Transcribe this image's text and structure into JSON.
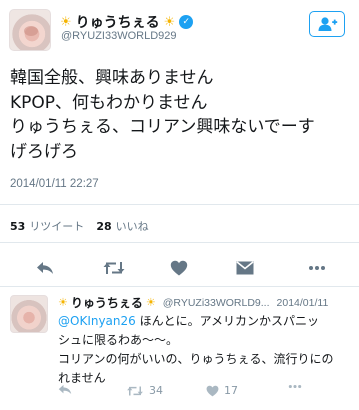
{
  "tweet": {
    "display_name": "りゅうちぇる",
    "handle": "@RYUZI33WORLD929",
    "lines": [
      "韓国全般、興味ありません",
      "KPOP、何もわかりません",
      "りゅうちぇる、コリアン興味ないでーす",
      "げろげろ"
    ],
    "timestamp": "2014/01/11 22:27",
    "retweet_count": "53",
    "retweet_label": "リツイート",
    "like_count": "28",
    "like_label": "いいね"
  },
  "reply": {
    "display_name": "りゅうちぇる",
    "handle": "@RYUZi33WORLD9...",
    "date": "2014/01/11",
    "mention": "@OKInyan26",
    "line1_rest": " ほんとに。アメリカンかスパニッ",
    "lines": [
      "シュに限るわあ〜〜。",
      "コリアンの何がいいの、りゅうちぇる、流行りにの",
      "れません"
    ],
    "retweet_count": "34",
    "like_count": "17"
  },
  "colors": {
    "accent": "#1da1f2",
    "icon_gray": "#657786",
    "text": "#14171a",
    "sun": "#f5b400"
  },
  "icons": [
    "sun-icon",
    "verified-badge-icon",
    "follow-icon",
    "reply-icon",
    "retweet-icon",
    "like-icon",
    "direct-message-icon",
    "more-icon"
  ]
}
